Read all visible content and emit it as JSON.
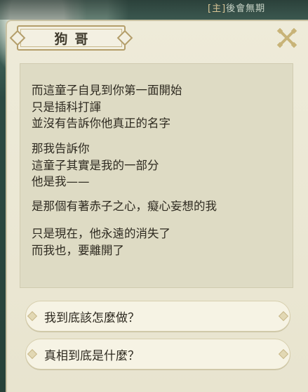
{
  "hud": {
    "prefix": "[主]",
    "text": "後會無期"
  },
  "dialog": {
    "speaker": "狗哥",
    "paragraphs": [
      {
        "lines": [
          "而這童子自見到你第一面開始",
          "只是插科打諢",
          "並沒有告訴你他真正的名字"
        ]
      },
      {
        "lines": [
          "那我告訴你",
          "這童子其實是我的一部分",
          "他是我——"
        ]
      },
      {
        "lines": [
          "是那個有著赤子之心，癡心妄想的我"
        ]
      },
      {
        "lines": [
          "只是現在，他永遠的消失了",
          "而我也，要離開了"
        ]
      }
    ],
    "choices": [
      {
        "label": "我到底該怎麼做？"
      },
      {
        "label": "真相到底是什麼？"
      }
    ]
  },
  "colors": {
    "panel": "#eeebd9",
    "content": "#dedbc4",
    "text": "#2e2a20",
    "accent": "#b49e6a"
  },
  "icons": {
    "close": "close-icon"
  }
}
